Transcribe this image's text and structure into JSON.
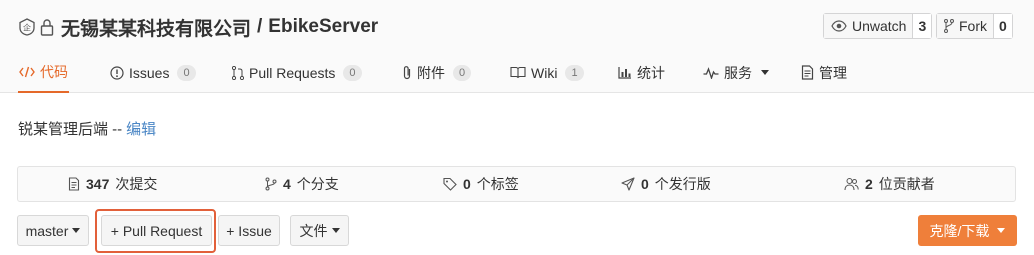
{
  "repo": {
    "owner": "无锡某某科技有限公司",
    "separator": "/",
    "name": "EbikeServer"
  },
  "actions": {
    "watch_label": "Unwatch",
    "watch_count": "3",
    "fork_label": "Fork",
    "fork_count": "0"
  },
  "tabs": [
    {
      "label": "代码",
      "icon": "code-icon",
      "active": true
    },
    {
      "label": "Issues",
      "badge": "0",
      "icon": "issue-icon"
    },
    {
      "label": "Pull Requests",
      "badge": "0",
      "icon": "pull-request-icon"
    },
    {
      "label": "附件",
      "badge": "0",
      "icon": "paperclip-icon"
    },
    {
      "label": "Wiki",
      "badge": "1",
      "icon": "book-icon"
    },
    {
      "label": "统计",
      "icon": "bar-chart-icon"
    },
    {
      "label": "服务",
      "icon": "pulse-icon",
      "dropdown": true
    },
    {
      "label": "管理",
      "icon": "document-icon"
    }
  ],
  "description": {
    "text": "锐某管理后端 --",
    "edit_link": "编辑"
  },
  "stats": [
    {
      "value": "347",
      "label": "次提交",
      "icon": "commit-icon"
    },
    {
      "value": "4",
      "label": "个分支",
      "icon": "branch-icon"
    },
    {
      "value": "0",
      "label": "个标签",
      "icon": "tag-icon"
    },
    {
      "value": "0",
      "label": "个发行版",
      "icon": "release-icon"
    },
    {
      "value": "2",
      "label": "位贡献者",
      "icon": "contributors-icon"
    }
  ],
  "toolbar": {
    "branch_label": "master",
    "pull_request_label": "+ Pull Request",
    "issue_label": "+ Issue",
    "file_label": "文件",
    "clone_label": "克隆/下载"
  },
  "colors": {
    "accent": "#e5692a",
    "clone_button": "#ef7f3a",
    "link": "#4a86c5",
    "highlight_box": "#e2603a"
  }
}
